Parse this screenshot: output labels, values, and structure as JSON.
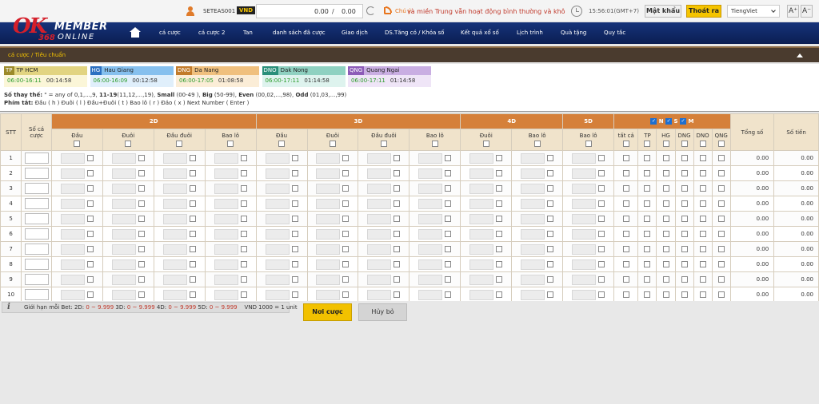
{
  "brand": {
    "ok": "OK",
    "num": "368",
    "member": "MEMBER",
    "online": "ONLINE"
  },
  "header": {
    "username": "SETEAS001",
    "currency": "VND",
    "balance_left": "0.00",
    "balance_sep": "/",
    "balance_right": "0.00",
    "notice_label": "Chú ý:",
    "notice_text": "và miền Trung vẫn hoạt động bình thường và khô",
    "clock": "15:56:01(GMT+7)",
    "password_btn": "Mật khẩu",
    "logout_btn": "Thoát ra",
    "language": "TiengViet",
    "font_up": "A⁺",
    "font_down": "A⁻"
  },
  "nav": {
    "items": [
      "cá cược",
      "cá cược 2",
      "Tan",
      "danh sách đã cược",
      "Giao dịch",
      "DS.Tăng có / Khóa số",
      "Kết quả xổ số",
      "Lịch trình",
      "Quà tặng",
      "Quy tắc"
    ]
  },
  "breadcrumb": "cá cược / Tiêu chuẩn",
  "provinces": [
    {
      "code": "TP",
      "name": "TP HCM",
      "open": "06:00-16:11",
      "countdown": "00:14:58",
      "code_color": "#9c8a2a",
      "head_color": "#e2d481",
      "body_color": "#fbf6d8"
    },
    {
      "code": "HG",
      "name": "Hau Giang",
      "open": "06:00-16:09",
      "countdown": "00:12:58",
      "code_color": "#2a6fc1",
      "head_color": "#86c0ee",
      "body_color": "#e0effb"
    },
    {
      "code": "DNG",
      "name": "Da Nang",
      "open": "06:00-17:05",
      "countdown": "01:08:58",
      "code_color": "#c27b2b",
      "head_color": "#f0c07e",
      "body_color": "#fbedd7"
    },
    {
      "code": "DNO",
      "name": "Dak Nong",
      "open": "06:00-17:11",
      "countdown": "01:14:58",
      "code_color": "#2a8f7a",
      "head_color": "#8fd1c1",
      "body_color": "#def3ee"
    },
    {
      "code": "QNG",
      "name": "Quang Ngai",
      "open": "06:00-17:11",
      "countdown": "01:14:58",
      "code_color": "#8d5bb8",
      "head_color": "#c9aee2",
      "body_color": "#efe5f7"
    }
  ],
  "hints": {
    "line1_prefix": "Số thay thế:",
    "line1_mid": " \" = any of 0,1,...,9, ",
    "line1_b1": "11-19",
    "line1_t1": "(11,12,...,19), ",
    "line1_b2": "Small",
    "line1_t2": " (00-49 ), ",
    "line1_b3": "Big",
    "line1_t3": " (50-99), ",
    "line1_b4": "Even",
    "line1_t4": " (00,02,...,98), ",
    "line1_b5": "Odd",
    "line1_t5": " (01,03,...,99)",
    "line2_prefix": "Phím tắt:",
    "line2_text": " Đầu ( h ) Đuôi ( l ) Đầu+Đuôi ( t ) Bao lô ( r ) Đảo ( x ) Next Number ( Enter )"
  },
  "table": {
    "col_stt": "STT",
    "col_so": "Số cá cược",
    "groups": [
      "2D",
      "3D",
      "4D",
      "5D"
    ],
    "cols_2d": [
      "Đầu",
      "Đuôi",
      "Đầu đuôi",
      "Bao lô"
    ],
    "cols_3d": [
      "Đầu",
      "Đuôi",
      "Đầu đuôi",
      "Bao lô"
    ],
    "cols_4d": [
      "Đuôi",
      "Bao lô"
    ],
    "cols_5d": [
      "Bao lô"
    ],
    "region_flags": [
      "N",
      "S",
      "M"
    ],
    "province_cols": [
      "tất cả",
      "TP",
      "HG",
      "DNG",
      "DNO",
      "QNG"
    ],
    "col_total": "Tổng số",
    "col_money": "Số tiền",
    "rows": [
      {
        "stt": "1",
        "total": "0.00",
        "money": "0.00"
      },
      {
        "stt": "2",
        "total": "0.00",
        "money": "0.00"
      },
      {
        "stt": "3",
        "total": "0.00",
        "money": "0.00"
      },
      {
        "stt": "4",
        "total": "0.00",
        "money": "0.00"
      },
      {
        "stt": "5",
        "total": "0.00",
        "money": "0.00"
      },
      {
        "stt": "6",
        "total": "0.00",
        "money": "0.00"
      },
      {
        "stt": "7",
        "total": "0.00",
        "money": "0.00"
      },
      {
        "stt": "8",
        "total": "0.00",
        "money": "0.00"
      },
      {
        "stt": "9",
        "total": "0.00",
        "money": "0.00"
      },
      {
        "stt": "10",
        "total": "0.00",
        "money": "0.00"
      }
    ]
  },
  "footer": {
    "limits_label": "Giới hạn mỗi Bet:",
    "l2": "2D:",
    "l2v": "0 ~ 9.999",
    "l3": "3D:",
    "l3v": "0 ~ 9.999",
    "l4": "4D:",
    "l4v": "0 ~ 9.999",
    "l5": "5D:",
    "l5v": "0 ~ 9.999",
    "unit": "VND 1000 = 1 unit",
    "submit": "Nơi cược",
    "cancel": "Hủy bỏ"
  }
}
